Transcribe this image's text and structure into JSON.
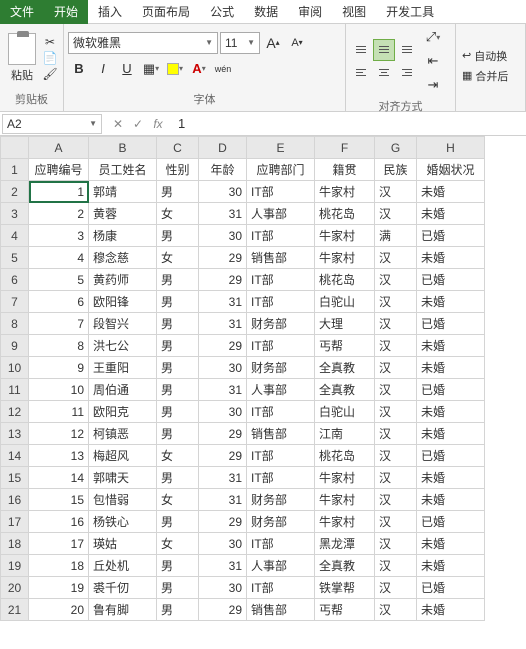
{
  "menu": {
    "file": "文件",
    "tabs": [
      "开始",
      "插入",
      "页面布局",
      "公式",
      "数据",
      "审阅",
      "视图",
      "开发工具"
    ],
    "active_index": 0
  },
  "ribbon": {
    "clipboard": {
      "paste": "粘贴",
      "label": "剪贴板"
    },
    "font": {
      "name": "微软雅黑",
      "size": "11",
      "label": "字体",
      "bold": "B",
      "italic": "I",
      "underline": "U",
      "increase": "A",
      "decrease": "A",
      "wen": "wén"
    },
    "align": {
      "label": "对齐方式"
    },
    "extra": {
      "autowrap": "自动换",
      "merge": "合并后"
    }
  },
  "refbar": {
    "name_box": "A2",
    "formula": "1"
  },
  "sheet": {
    "columns": [
      "A",
      "B",
      "C",
      "D",
      "E",
      "F",
      "G",
      "H"
    ],
    "headers": [
      "应聘编号",
      "员工姓名",
      "性别",
      "年龄",
      "应聘部门",
      "籍贯",
      "民族",
      "婚姻状况"
    ],
    "rows": [
      {
        "id": "1",
        "name": "郭靖",
        "gender": "男",
        "age": "30",
        "dept": "IT部",
        "origin": "牛家村",
        "ethnic": "汉",
        "marital": "未婚"
      },
      {
        "id": "2",
        "name": "黄蓉",
        "gender": "女",
        "age": "31",
        "dept": "人事部",
        "origin": "桃花岛",
        "ethnic": "汉",
        "marital": "未婚"
      },
      {
        "id": "3",
        "name": "杨康",
        "gender": "男",
        "age": "30",
        "dept": "IT部",
        "origin": "牛家村",
        "ethnic": "满",
        "marital": "已婚"
      },
      {
        "id": "4",
        "name": "穆念慈",
        "gender": "女",
        "age": "29",
        "dept": "销售部",
        "origin": "牛家村",
        "ethnic": "汉",
        "marital": "未婚"
      },
      {
        "id": "5",
        "name": "黄药师",
        "gender": "男",
        "age": "29",
        "dept": "IT部",
        "origin": "桃花岛",
        "ethnic": "汉",
        "marital": "已婚"
      },
      {
        "id": "6",
        "name": "欧阳锋",
        "gender": "男",
        "age": "31",
        "dept": "IT部",
        "origin": "白驼山",
        "ethnic": "汉",
        "marital": "未婚"
      },
      {
        "id": "7",
        "name": "段智兴",
        "gender": "男",
        "age": "31",
        "dept": "财务部",
        "origin": "大理",
        "ethnic": "汉",
        "marital": "已婚"
      },
      {
        "id": "8",
        "name": "洪七公",
        "gender": "男",
        "age": "29",
        "dept": "IT部",
        "origin": "丐帮",
        "ethnic": "汉",
        "marital": "未婚"
      },
      {
        "id": "9",
        "name": "王重阳",
        "gender": "男",
        "age": "30",
        "dept": "财务部",
        "origin": "全真教",
        "ethnic": "汉",
        "marital": "未婚"
      },
      {
        "id": "10",
        "name": "周伯通",
        "gender": "男",
        "age": "31",
        "dept": "人事部",
        "origin": "全真教",
        "ethnic": "汉",
        "marital": "已婚"
      },
      {
        "id": "11",
        "name": "欧阳克",
        "gender": "男",
        "age": "30",
        "dept": "IT部",
        "origin": "白驼山",
        "ethnic": "汉",
        "marital": "未婚"
      },
      {
        "id": "12",
        "name": "柯镇恶",
        "gender": "男",
        "age": "29",
        "dept": "销售部",
        "origin": "江南",
        "ethnic": "汉",
        "marital": "未婚"
      },
      {
        "id": "13",
        "name": "梅超风",
        "gender": "女",
        "age": "29",
        "dept": "IT部",
        "origin": "桃花岛",
        "ethnic": "汉",
        "marital": "已婚"
      },
      {
        "id": "14",
        "name": "郭啸天",
        "gender": "男",
        "age": "31",
        "dept": "IT部",
        "origin": "牛家村",
        "ethnic": "汉",
        "marital": "未婚"
      },
      {
        "id": "15",
        "name": "包惜弱",
        "gender": "女",
        "age": "31",
        "dept": "财务部",
        "origin": "牛家村",
        "ethnic": "汉",
        "marital": "未婚"
      },
      {
        "id": "16",
        "name": "杨铁心",
        "gender": "男",
        "age": "29",
        "dept": "财务部",
        "origin": "牛家村",
        "ethnic": "汉",
        "marital": "已婚"
      },
      {
        "id": "17",
        "name": "瑛姑",
        "gender": "女",
        "age": "30",
        "dept": "IT部",
        "origin": "黑龙潭",
        "ethnic": "汉",
        "marital": "未婚"
      },
      {
        "id": "18",
        "name": "丘处机",
        "gender": "男",
        "age": "31",
        "dept": "人事部",
        "origin": "全真教",
        "ethnic": "汉",
        "marital": "未婚"
      },
      {
        "id": "19",
        "name": "裘千仞",
        "gender": "男",
        "age": "30",
        "dept": "IT部",
        "origin": "铁掌帮",
        "ethnic": "汉",
        "marital": "已婚"
      },
      {
        "id": "20",
        "name": "鲁有脚",
        "gender": "男",
        "age": "29",
        "dept": "销售部",
        "origin": "丐帮",
        "ethnic": "汉",
        "marital": "未婚"
      }
    ]
  }
}
